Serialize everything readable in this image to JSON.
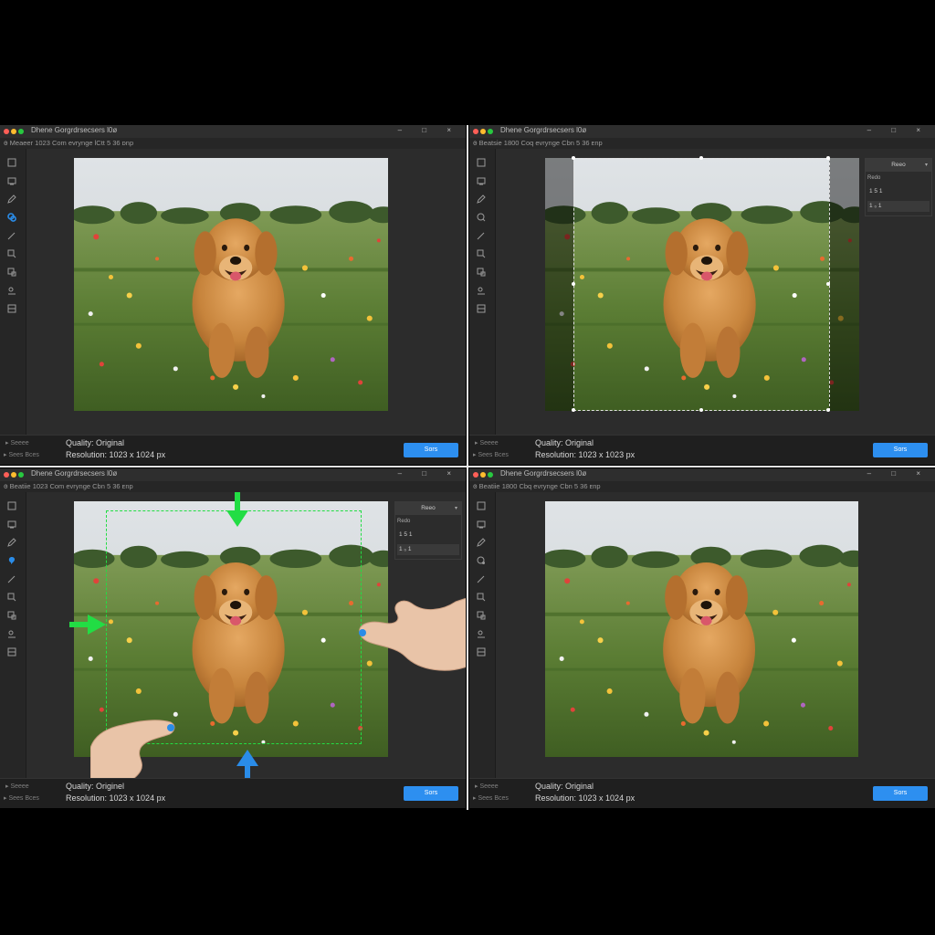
{
  "app": {
    "window_title": "Dhene Gorgrdrsecsers l0ø",
    "window_controls": "– □ ×"
  },
  "panels": [
    {
      "window_title": "Dhene Gorgrdrsecsers l0ø",
      "menu_text": "ꙩ Meaeer 1023  Com  evrynge  lCtt 5 36 ᴅnp",
      "status_left_1": "▸  Seeee",
      "status_left_2": "▸ Sees Bces",
      "quality": "Quality: Original",
      "resolution": "Resolution: 1023 x 1024 px",
      "save_label": "Sors"
    },
    {
      "window_title": "Dhene Gorgrdrsecsers l0ø",
      "menu_text": "ꙩ Beatsie 1800  Coq  evrynge  Cbn 5 36 ᴇnp",
      "status_left_1": "▸  Seeee",
      "status_left_2": "▸ Sees Bces",
      "quality": "Quality: Original",
      "resolution": "Resolution: 1023 x 1023 px",
      "save_label": "Sors",
      "ratio_panel": {
        "header": "Reeo",
        "label": "Redo",
        "options": [
          "1 5 1",
          "1 ₀ 1"
        ]
      }
    },
    {
      "window_title": "Dhene Gorgrdrsecsers l0ø",
      "menu_text": "ꙩ Beatiie 1023  Com  evrynge  Cbn 5 36 ᴇnp",
      "status_left_1": "▸  Seeee",
      "status_left_2": "▸ Sees Bces",
      "quality": "Quality: Originel",
      "resolution": "Resolution: 1023 x 1024 px",
      "save_label": "Sors",
      "ratio_panel": {
        "header": "Reeo",
        "label": "Redo",
        "options": [
          "1 5 1",
          "1 ₀ 1"
        ]
      }
    },
    {
      "window_title": "Dhene Gorgrdrsecsers l0ø",
      "menu_text": "ꙩ Beatiie 1800  Cbq  evrynge  Cbn 5 36 ᴇnp",
      "status_left_1": "▸  Seeee",
      "status_left_2": "▸ Sees Bces",
      "quality": "Quality: Original",
      "resolution": "Resolution: 1023 x 1024 px",
      "save_label": "Sors"
    }
  ],
  "tools": [
    "crop-icon",
    "frame-icon",
    "pen-icon",
    "lasso-icon",
    "brush-icon",
    "stamp-icon",
    "transform-icon",
    "eyedropper-icon",
    "layers-icon"
  ],
  "colors": {
    "accent": "#2d8ff0",
    "guide_green": "#22dd44",
    "arrow_blue": "#2a8ce8",
    "panel_bg": "#232323"
  }
}
